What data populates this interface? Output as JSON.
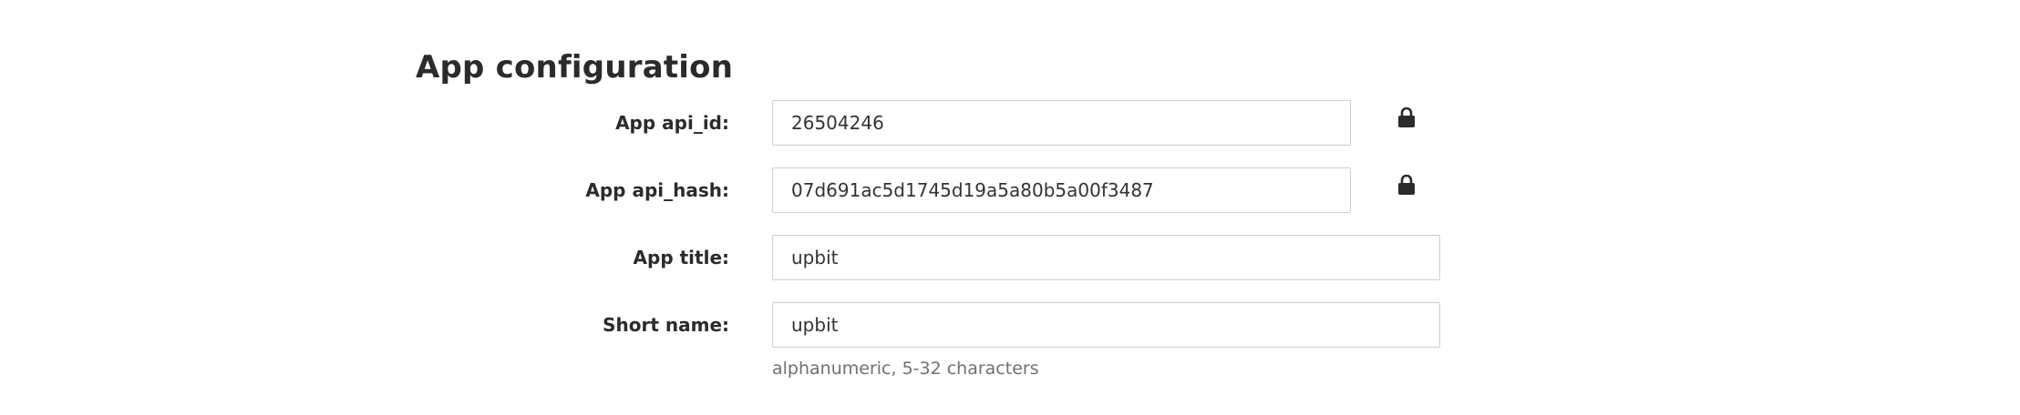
{
  "page": {
    "title": "App configuration"
  },
  "fields": {
    "api_id": {
      "label": "App api_id:",
      "value": "26504246",
      "locked": true
    },
    "api_hash": {
      "label": "App api_hash:",
      "value": "07d691ac5d1745d19a5a80b5a00f3487",
      "locked": true
    },
    "app_title": {
      "label": "App title:",
      "value": "upbit"
    },
    "short_name": {
      "label": "Short name:",
      "value": "upbit",
      "hint": "alphanumeric, 5-32 characters"
    }
  },
  "icons": {
    "lock": "lock-icon"
  },
  "colors": {
    "text": "#2b2b2b",
    "hint": "#707070",
    "border": "#cfcfcf"
  }
}
